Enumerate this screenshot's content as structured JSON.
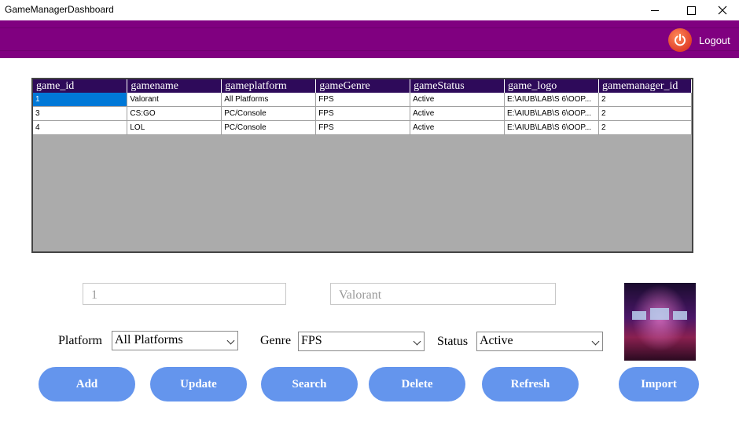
{
  "window": {
    "title": "GameManagerDashboard",
    "controls": [
      "minimize-icon",
      "maximize-icon",
      "close-icon"
    ]
  },
  "header": {
    "logout_label": "Logout",
    "logout_icon": "power-icon",
    "background": "#800080"
  },
  "grid": {
    "columns": [
      "game_id",
      "gamename",
      "gameplatform",
      "gameGenre",
      "gameStatus",
      "game_logo",
      "gamemanager_id"
    ],
    "rows": [
      [
        "1",
        "Valorant",
        "All Platforms",
        "FPS",
        "Active",
        "E:\\AIUB\\LAB\\S 6\\OOP...",
        "2"
      ],
      [
        "3",
        "CS:GO",
        "PC/Console",
        "FPS",
        "Active",
        "E:\\AIUB\\LAB\\S 6\\OOP...",
        "2"
      ],
      [
        "4",
        "LOL",
        "PC/Console",
        "FPS",
        "Active",
        "E:\\AIUB\\LAB\\S 6\\OOP...",
        "2"
      ]
    ],
    "header_color": "#2e0a5a",
    "selection_color": "#0078d7"
  },
  "form": {
    "id_value": "1",
    "name_value": "Valorant",
    "platform_label": "Platform",
    "platform_value": "All Platforms",
    "genre_label": "Genre",
    "genre_value": "FPS",
    "status_label": "Status",
    "status_value": "Active"
  },
  "buttons": {
    "add": "Add",
    "update": "Update",
    "search": "Search",
    "delete": "Delete",
    "refresh": "Refresh",
    "import": "Import",
    "color": "#6495ed"
  }
}
